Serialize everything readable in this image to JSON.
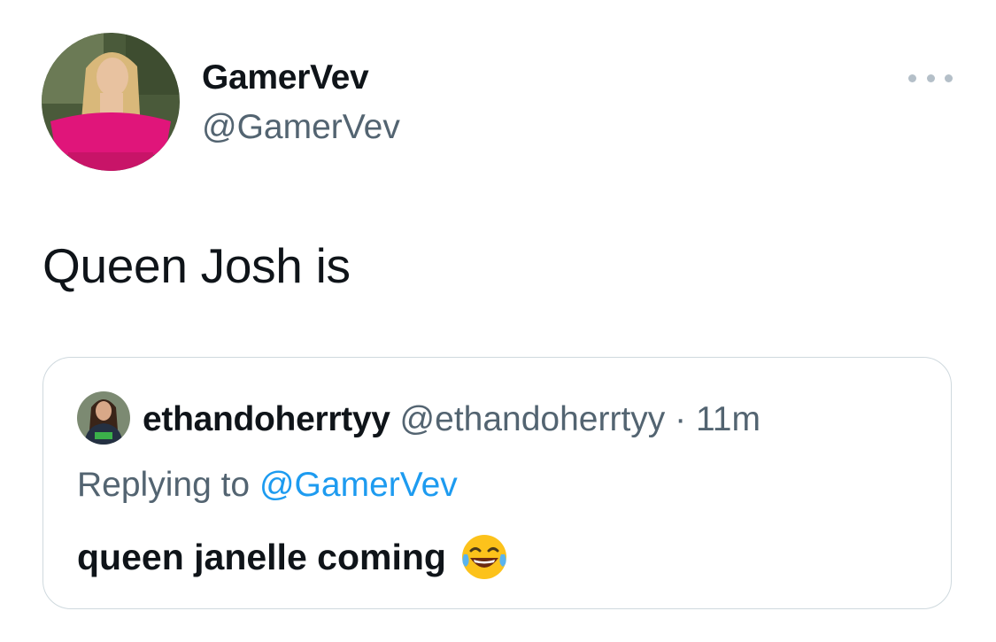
{
  "tweet": {
    "author": {
      "display_name": "GamerVev",
      "handle": "@GamerVev",
      "avatar_icon": "avatar-woman-pink-top"
    },
    "text": "Queen Josh is",
    "more_icon": "more-horizontal-icon"
  },
  "quote": {
    "author": {
      "display_name": "ethandoherrtyy",
      "handle": "@ethandoherrtyy",
      "avatar_icon": "avatar-woman-green-shirt"
    },
    "separator": "·",
    "time": "11m",
    "replying_prefix": "Replying to",
    "replying_to": "@GamerVev",
    "text": "queen janelle coming",
    "emoji": "face-with-tears-of-joy"
  },
  "colors": {
    "text_primary": "#0f1419",
    "text_secondary": "#536471",
    "link": "#1d9bf0",
    "border": "#cfd9de"
  }
}
